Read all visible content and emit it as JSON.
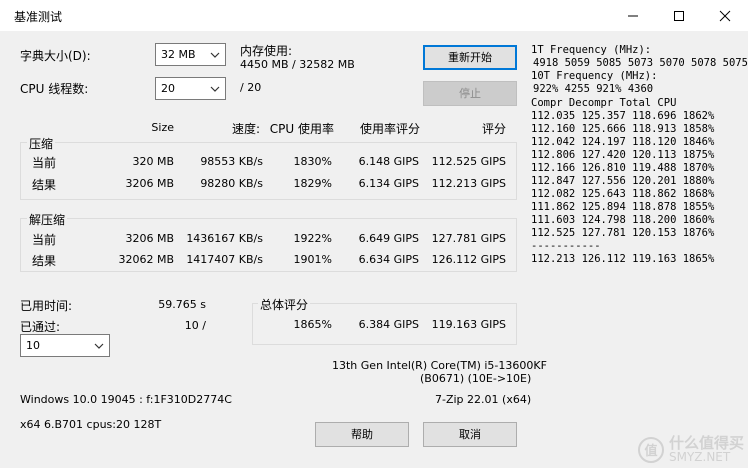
{
  "window": {
    "title": "基准测试"
  },
  "controls": {
    "dict_label": "字典大小(D):",
    "dict_value": "32 MB",
    "threads_label": "CPU 线程数:",
    "threads_value": "20",
    "threads_total": "/ 20",
    "memory_label": "内存使用:",
    "memory_value": "4450 MB / 32582 MB",
    "restart_label": "重新开始",
    "stop_label": "停止"
  },
  "columns": {
    "size": "Size",
    "speed": "速度:",
    "cpu_usage": "CPU 使用率",
    "usage_rating": "使用率评分",
    "rating": "评分"
  },
  "compress": {
    "title": "压缩",
    "rows": [
      {
        "label": "当前",
        "size": "320 MB",
        "speed": "98553 KB/s",
        "cpu": "1830%",
        "usage_rating": "6.148 GIPS",
        "rating": "112.525 GIPS"
      },
      {
        "label": "结果",
        "size": "3206 MB",
        "speed": "98280 KB/s",
        "cpu": "1829%",
        "usage_rating": "6.134 GIPS",
        "rating": "112.213 GIPS"
      }
    ]
  },
  "decompress": {
    "title": "解压缩",
    "rows": [
      {
        "label": "当前",
        "size": "3206 MB",
        "speed": "1436167 KB/s",
        "cpu": "1922%",
        "usage_rating": "6.649 GIPS",
        "rating": "127.781 GIPS"
      },
      {
        "label": "结果",
        "size": "32062 MB",
        "speed": "1417407 KB/s",
        "cpu": "1901%",
        "usage_rating": "6.634 GIPS",
        "rating": "126.112 GIPS"
      }
    ]
  },
  "elapsed": {
    "label": "已用时间:",
    "value": "59.765 s"
  },
  "passed": {
    "label": "已通过:",
    "value": "10 /",
    "select_value": "10"
  },
  "total": {
    "title": "总体评分",
    "cpu": "1865%",
    "usage_rating": "6.384 GIPS",
    "rating": "119.163 GIPS"
  },
  "cpu_info": {
    "line1": "13th Gen Intel(R) Core(TM) i5-13600KF",
    "line2": "(B0671) (10E->10E)"
  },
  "os_info": "Windows 10.0 19045 : f:1F310D2774C",
  "version": "7-Zip 22.01 (x64)",
  "arch_info": "x64 6.B701 cpus:20 128T",
  "help_label": "帮助",
  "cancel_label": "取消",
  "freq": {
    "line1_label": "1T Frequency (MHz):",
    "line1_values": "4918 5059 5085 5073 5070 5078 5075",
    "line2_label": "10T Frequency (MHz):",
    "line2_values": "922% 4255 921% 4360",
    "header": "Compr Decompr Total   CPU",
    "rows": [
      "112.035  125.357  118.696  1862%",
      "112.160  125.666  118.913  1858%",
      "112.042  124.197  118.120  1846%",
      "112.806  127.420  120.113  1875%",
      "112.166  126.810  119.488  1870%",
      "112.847  127.556  120.201  1880%",
      "112.082  125.643  118.862  1868%",
      "111.862  125.894  118.878  1855%",
      "111.603  124.798  118.200  1860%",
      "112.525  127.781  120.153  1876%"
    ],
    "separator": "-----------",
    "total_row": "112.213  126.112  119.163  1865%"
  },
  "watermark": {
    "text": "什么值得买",
    "site": "SMYZ.NET"
  }
}
